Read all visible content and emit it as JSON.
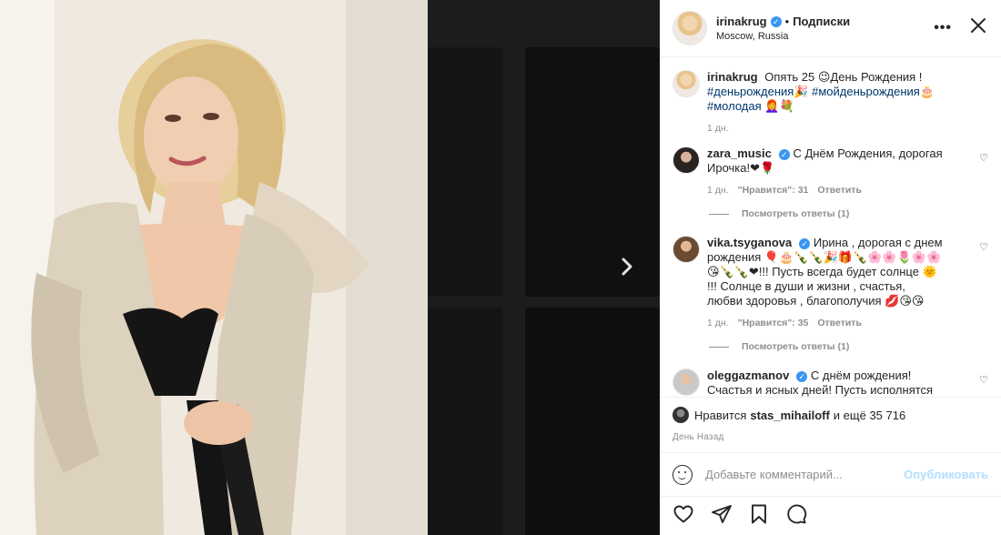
{
  "post": {
    "author": "irinakrug",
    "follow_label": "Подписки",
    "location": "Moscow, Russia",
    "more_label": "•••",
    "close_label": "✕"
  },
  "caption": {
    "author": "irinakrug",
    "text": "Опять 25 😉День Рождения !",
    "tags_line1": "#деньрождения🎉 #мойденьрождения🎂",
    "tags_line2": "#молодая 👩‍🦰💐",
    "time": "1 дн."
  },
  "comments": [
    {
      "author": "zara_music",
      "text": "С Днём Рождения, дорогая Ирочка!❤🌹",
      "time": "1 дн.",
      "likes": "\"Нравится\": 31",
      "reply": "Ответить",
      "replies": "Посмотреть ответы (1)"
    },
    {
      "author": "vika.tsyganova",
      "text": "Ирина , дорогая с днем рождения 🎈🎂🍾🍾🎉🎁🍾🌸🌸🌷🌸🌸😘🍾🍾❤!!! Пусть всегда будет солнце 🌞 !!! Солнце в души и жизни , счастья, любви здоровья , благополучия 💋😘😘",
      "time": "1 дн.",
      "likes": "\"Нравится\": 35",
      "reply": "Ответить",
      "replies": "Посмотреть ответы (1)"
    },
    {
      "author": "oleggazmanov",
      "text": "С днём рождения! Счастья и ясных дней! Пусть исполнятся твои желания! ❤💐💐💐🥂🎤",
      "time": "",
      "likes": "",
      "reply": "",
      "replies": ""
    }
  ],
  "likes": {
    "prefix": "Нравится",
    "user": "stas_mihailoff",
    "suffix": "и ещё 35 716"
  },
  "date_label": "День Назад",
  "add_comment": {
    "placeholder": "Добавьте комментарий...",
    "publish_label": "Опубликовать"
  },
  "colors": {
    "verified": "#3897f0",
    "publish_disabled": "#b2dffc",
    "link": "#00376b"
  },
  "icons": [
    "heart-icon",
    "share-icon",
    "bookmark-icon",
    "comment-icon",
    "smile-icon",
    "verified-icon",
    "chevron-right-icon",
    "close-icon",
    "more-icon"
  ]
}
